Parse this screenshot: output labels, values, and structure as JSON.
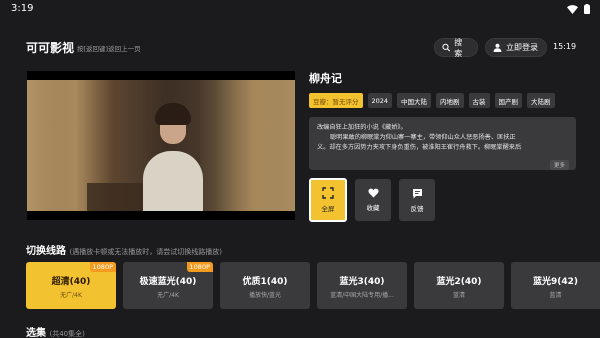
{
  "status_bar": {
    "time": "3:19"
  },
  "header": {
    "app_title": "可可影视",
    "hint": "按[返回键]返回上一页",
    "search_label": "搜索",
    "login_label": "立即登录",
    "clock": "15:19"
  },
  "show": {
    "title": "柳舟记",
    "tags": [
      {
        "label": "豆瓣：暂无评分",
        "style": "rating"
      },
      {
        "label": "2024"
      },
      {
        "label": "中国大陆"
      },
      {
        "label": "内地剧"
      },
      {
        "label": "古装"
      },
      {
        "label": "国产剧"
      },
      {
        "label": "大陆剧"
      }
    ],
    "description_line1": "改编自狂上加狂的小说《藏娇》。",
    "description_line2": "聪明果敢的柳眠棠为仰山寨一寨主，带领仰山众人惩恶扬善、匡扶正",
    "description_line3": "义。却在多方因势力夹攻下身负重伤，被淮阳王崔行舟救下。柳眠棠醒来后",
    "more_label": "更多"
  },
  "actions": {
    "fullscreen": "全屏",
    "favorite": "收藏",
    "feedback": "反馈"
  },
  "lines": {
    "title": "切换线路",
    "subtitle": "(遇播放卡顿或无法播放时，请尝试切换线路播放)",
    "items": [
      {
        "name": "超清(40)",
        "sub": "无广/4K",
        "badge": "1080P",
        "active": true
      },
      {
        "name": "极速蓝光(40)",
        "sub": "无广/4K",
        "badge": "1080P"
      },
      {
        "name": "优质1(40)",
        "sub": "播放快/蓝光"
      },
      {
        "name": "蓝光3(40)",
        "sub": "蓝清/中国大陆专用/播..."
      },
      {
        "name": "蓝光2(40)",
        "sub": "蓝清"
      },
      {
        "name": "蓝光9(42)",
        "sub": "蓝清"
      }
    ]
  },
  "episodes": {
    "title": "选集",
    "subtitle": "(共40集全)"
  },
  "colors": {
    "accent": "#f2c230",
    "badge": "#f49a1e",
    "background": "#1b1b1d",
    "card": "#3a3a3d"
  }
}
